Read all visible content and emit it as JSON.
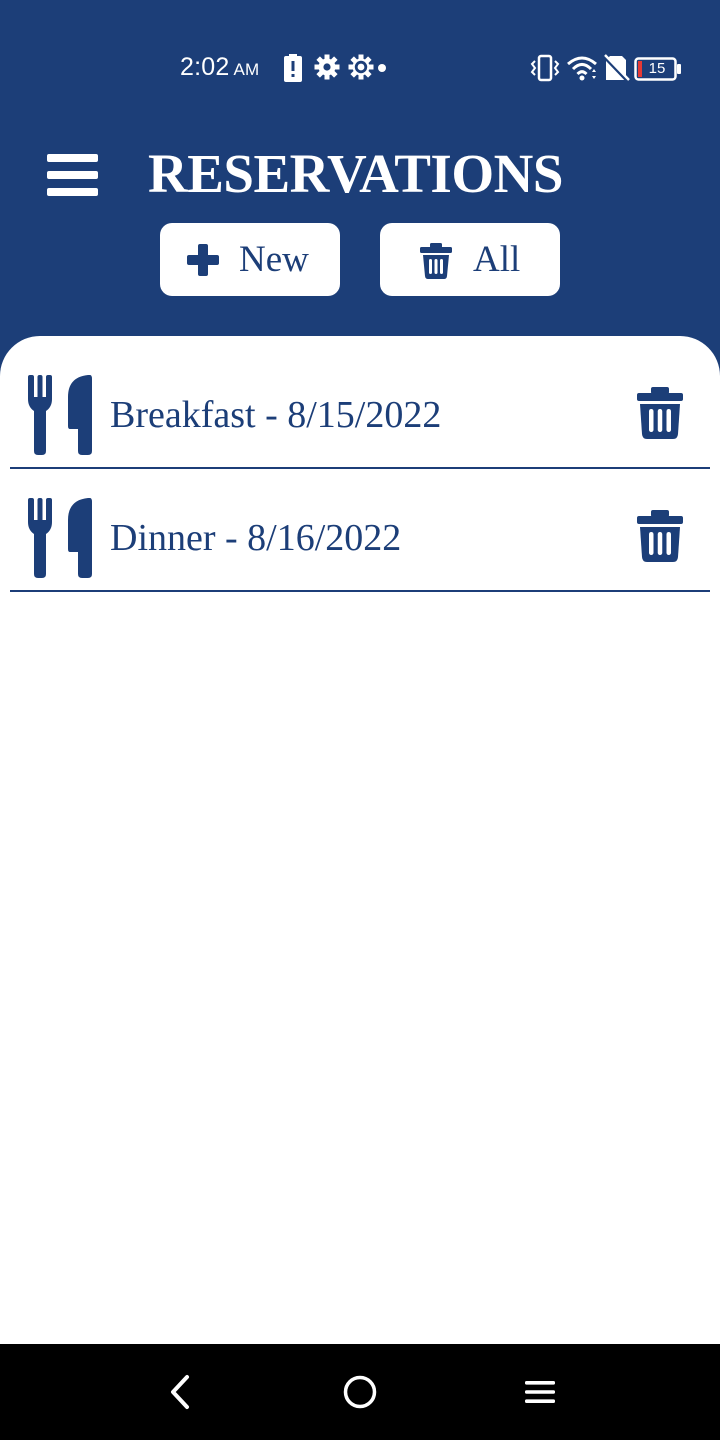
{
  "colors": {
    "primary": "#1c3e78",
    "surface": "#ffffff",
    "nav_bar": "#000000",
    "battery_low": "#e53935"
  },
  "status_bar": {
    "time": "2:02",
    "ampm": "AM",
    "battery_level": "15",
    "icons": [
      "battery-alert-icon",
      "settings-icon",
      "settings-outline-icon",
      "notification-dot-icon",
      "vibrate-icon",
      "wifi-icon",
      "no-sim-icon",
      "battery-icon"
    ]
  },
  "app_bar": {
    "title": "RESERVATIONS",
    "menu_icon": "hamburger-menu-icon"
  },
  "actions": {
    "new_label": "New",
    "new_icon": "plus-icon",
    "clear_all_label": "All",
    "clear_all_icon": "trash-icon"
  },
  "reservations": [
    {
      "label": "Breakfast - 8/15/2022",
      "icon": "utensils-icon",
      "delete_icon": "trash-icon"
    },
    {
      "label": "Dinner - 8/16/2022",
      "icon": "utensils-icon",
      "delete_icon": "trash-icon"
    }
  ],
  "nav_bar": {
    "buttons": [
      "back-icon",
      "home-icon",
      "recents-icon"
    ]
  }
}
